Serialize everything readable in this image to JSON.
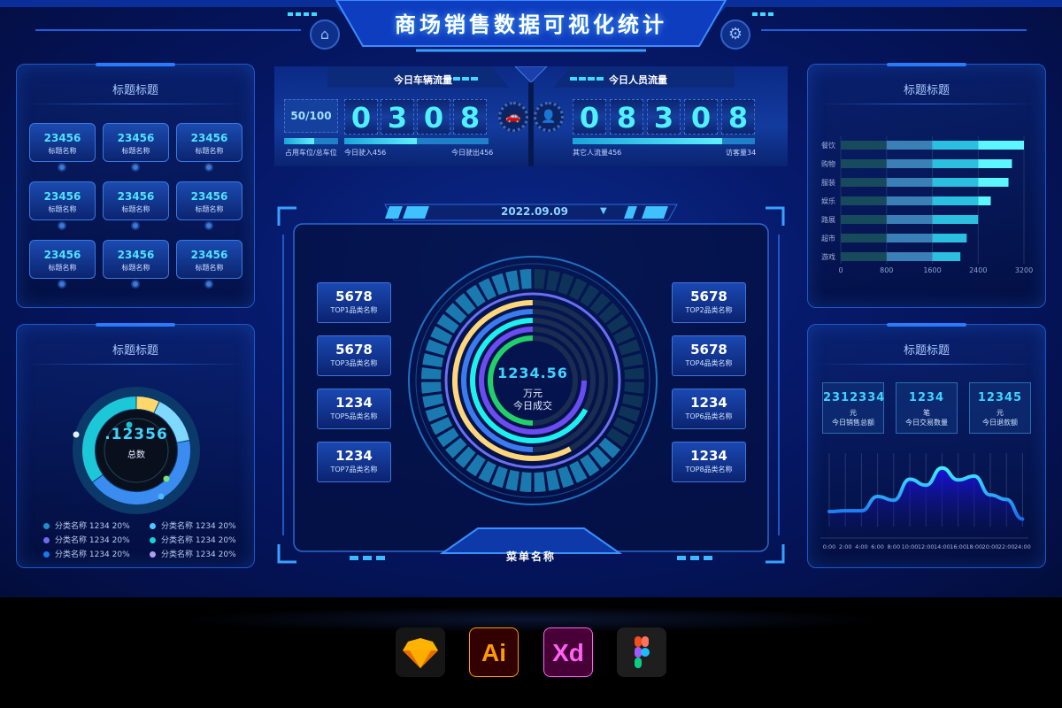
{
  "header": {
    "title": "商场销售数据可视化统计",
    "home_icon": "home-icon",
    "settings_icon": "gear-icon"
  },
  "left_top": {
    "title": "标题标题",
    "cards": [
      {
        "value": "23456",
        "label": "标题名称"
      },
      {
        "value": "23456",
        "label": "标题名称"
      },
      {
        "value": "23456",
        "label": "标题名称"
      },
      {
        "value": "23456",
        "label": "标题名称"
      },
      {
        "value": "23456",
        "label": "标题名称"
      },
      {
        "value": "23456",
        "label": "标题名称"
      },
      {
        "value": "23456",
        "label": "标题名称"
      },
      {
        "value": "23456",
        "label": "标题名称"
      },
      {
        "value": "23456",
        "label": "标题名称"
      }
    ]
  },
  "left_bottom": {
    "title": "标题标题",
    "total_value": ".12356",
    "total_label": "总数",
    "donut_segments": [
      {
        "color": "#ffd76a",
        "fraction": 0.07
      },
      {
        "color": "#7fd8ff",
        "fraction": 0.15
      },
      {
        "color": "#3a8cf0",
        "fraction": 0.43
      },
      {
        "color": "#1cc8d8",
        "fraction": 0.35
      }
    ],
    "legend": [
      {
        "text": "分类名称 1234 20%",
        "color": "#1b8fd0"
      },
      {
        "text": "分类名称 1234 20%",
        "color": "#4fc8ff"
      },
      {
        "text": "分类名称 1234 20%",
        "color": "#6a6cf0"
      },
      {
        "text": "分类名称 1234 20%",
        "color": "#1ad0d8"
      },
      {
        "text": "分类名称 1234 20%",
        "color": "#1a78f0"
      },
      {
        "text": "分类名称 1234 20%",
        "color": "#b09ef0"
      }
    ]
  },
  "vehicle": {
    "title": "今日车辆流量",
    "parking": "50/100",
    "parking_fraction": 0.55,
    "parking_label": "占用车位/总车位",
    "digits": [
      "0",
      "3",
      "0",
      "8"
    ],
    "in_label": "今日驶入456",
    "out_label": "今日驶出456",
    "in_fraction": 0.5,
    "icon": "car-icon"
  },
  "people": {
    "title": "今日人员流量",
    "digits": [
      "0",
      "8",
      "3",
      "0",
      "8"
    ],
    "other_label": "其它人流量456",
    "visitor_label": "访客量34",
    "fraction": 0.82,
    "icon": "person-icon"
  },
  "center": {
    "date": "2022.09.09",
    "value": "1234.56",
    "unit": "万元",
    "label": "今日成交",
    "menu": "菜单名称",
    "rings": [
      {
        "color": "#ffd77a",
        "fraction": 0.58
      },
      {
        "color": "#3a7cf0",
        "fraction": 0.5
      },
      {
        "color": "#1ef0f0",
        "fraction": 0.67
      },
      {
        "color": "#6a4cf0",
        "fraction": 0.75
      },
      {
        "color": "#22d06a",
        "fraction": 0.5
      }
    ],
    "top_left": [
      {
        "value": "5678",
        "label": "TOP1品类名称"
      },
      {
        "value": "5678",
        "label": "TOP3品类名称"
      },
      {
        "value": "1234",
        "label": "TOP5品类名称"
      },
      {
        "value": "1234",
        "label": "TOP7品类名称"
      }
    ],
    "top_right": [
      {
        "value": "5678",
        "label": "TOP2品类名称"
      },
      {
        "value": "5678",
        "label": "TOP4品类名称"
      },
      {
        "value": "1234",
        "label": "TOP6品类名称"
      },
      {
        "value": "1234",
        "label": "TOP8品类名称"
      }
    ]
  },
  "right_top": {
    "title": "标题标题"
  },
  "right_bottom": {
    "title": "标题标题",
    "stats": [
      {
        "value": "2312334",
        "unit": "元",
        "label": "今日销售总额"
      },
      {
        "value": "1234",
        "unit": "笔",
        "label": "今日交易数量"
      },
      {
        "value": "12345",
        "unit": "元",
        "label": "今日退款额"
      }
    ]
  },
  "chart_data": [
    {
      "type": "bar",
      "orientation": "horizontal",
      "stacked_bands": [
        800,
        1600,
        2400
      ],
      "band_colors": [
        "#174a5c",
        "#3a80b6",
        "#2cc0e0",
        "#5cf6ff"
      ],
      "categories": [
        "餐饮",
        "购物",
        "服装",
        "娱乐",
        "路展",
        "超市",
        "游戏"
      ],
      "values": [
        3200,
        2990,
        2930,
        2620,
        2400,
        2200,
        2090
      ],
      "xlim": [
        0,
        3200
      ],
      "xticks": [
        "0",
        "800",
        "1600",
        "2400",
        "3200"
      ],
      "grid": true
    },
    {
      "type": "area",
      "x": [
        "0:00",
        "2:00",
        "4:00",
        "6:00",
        "8:00",
        "10:00",
        "12:00",
        "14:00",
        "16:00",
        "18:00",
        "20:00",
        "22:00",
        "24:00"
      ],
      "values": [
        20,
        21,
        21,
        40,
        35,
        63,
        55,
        78,
        62,
        67,
        42,
        36,
        10
      ],
      "ylim": [
        0,
        100
      ],
      "grid": true
    }
  ],
  "apps": [
    {
      "name": "Sketch",
      "label": ""
    },
    {
      "name": "Illustrator",
      "label": "Ai"
    },
    {
      "name": "XD",
      "label": "Xd"
    },
    {
      "name": "Figma",
      "label": ""
    }
  ]
}
